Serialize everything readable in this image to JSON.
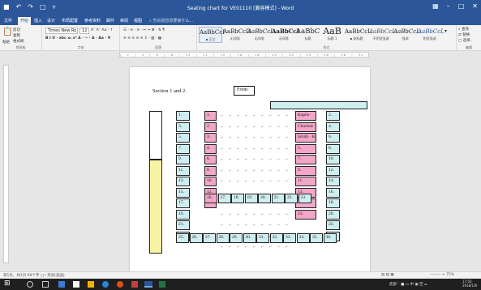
{
  "window": {
    "title": "Seating chart for VE01110 [兼容模式] - Word",
    "qat": [
      "■",
      "↶",
      "↷",
      "□",
      "▿"
    ],
    "controls": [
      "–",
      "□",
      "✕"
    ],
    "ribbon_options_icon": "▦"
  },
  "tabs": [
    "文件",
    "开始",
    "插入",
    "设计",
    "布局配置",
    "参考资料",
    "邮件",
    "审阅",
    "视图",
    "⌕ 告诉我您想要做什么..."
  ],
  "ribbon": {
    "clipboard": {
      "paste": "粘贴",
      "cut": "剪切",
      "copy": "复制",
      "painter": "格式刷",
      "label": "剪贴板"
    },
    "font": {
      "name": "Times New Ro",
      "size": "12",
      "label": "字体",
      "row2": "B  I  U · abc x₂ x²  A · ✑ · A · Aa · ∀",
      "row1_tail": "A˄ A˅ Aa · ↑"
    },
    "paragraph": {
      "label": "段落",
      "row1": "☰ · ≡ · ≡ · ⇐ ⇒ ✘ · ⇅  ¶",
      "row2": "≡ ≡ ≡ ≡ ≡  ↕ · ▨ · ▦ ·"
    },
    "styles": {
      "label": "样式",
      "items": [
        {
          "preview": "AaBbCcI",
          "name": "▪ 正文"
        },
        {
          "preview": "AaBbCcD",
          "name": "无间隔"
        },
        {
          "preview": "AaBbCcL",
          "name": "无间隔"
        },
        {
          "preview": "AaBbCcI",
          "name": "无间隔"
        },
        {
          "preview": "AaBbC",
          "name": "标题"
        },
        {
          "preview": "AaB",
          "name": "标题 1"
        },
        {
          "preview": "AaBbCcL",
          "name": "▪ 副标题"
        },
        {
          "preview": "AaBbCcL",
          "name": "不明显强调"
        },
        {
          "preview": "AaBbCcL",
          "name": "强调"
        },
        {
          "preview": "AaBbCcL",
          "name": "明显强调"
        }
      ]
    },
    "editing": {
      "find": "⌕ 查找 ·",
      "replace": "⇄ 替换",
      "select": "▢ 选择 ·",
      "label": "编辑"
    }
  },
  "document": {
    "heading": "Section 1 and 2·",
    "front_label": "Front·",
    "para_mark": "↵",
    "seats_col_a": [
      "1.",
      "3.",
      "5.",
      "7.",
      "9.",
      "11.",
      "13.",
      "15.",
      "17.",
      "19.",
      "21.",
      "23."
    ],
    "seats_col_b": [
      "1.",
      "2.",
      "3.",
      "4.",
      "6.",
      "8.",
      "10.",
      "12.",
      "14."
    ],
    "seats_right": [
      "2.",
      "4.",
      "6.",
      "8.",
      "10.",
      "12.",
      "14.",
      "16.",
      "18.",
      "20.",
      "22.",
      "24."
    ],
    "row_16": [
      "16.",
      "17.",
      "18.",
      "19.",
      "20.",
      "21.",
      "22.",
      "23."
    ],
    "pink_names": [
      "Kaptis·",
      "Charisse·",
      "Smith · Kambi·",
      "5.",
      "7.",
      "9.",
      "11.",
      "13.",
      "15.",
      "23."
    ],
    "bottom_row": [
      "25.",
      "26.",
      "27.",
      "28.",
      "29.",
      "30.",
      "31.",
      "32.",
      "33.",
      "34.",
      "35.",
      "36."
    ]
  },
  "status": {
    "left": "第1页，共2页   69个字   □•   英语(美国)",
    "zoom_pct": "——— + 75%",
    "view_icons": "▤ ▥ ▦"
  },
  "taskbar": {
    "start": "⊞",
    "tray": "底部 ˄  ■ ▭ 中  ▣  空  ⌓",
    "clock": "17:03\n2018/1/8"
  },
  "colors": {
    "word_blue": "#2b579a",
    "cyan_fill": "#cfeef0",
    "pink_fill": "#f2a6c8",
    "yellow_fill": "#f8f4a6"
  }
}
